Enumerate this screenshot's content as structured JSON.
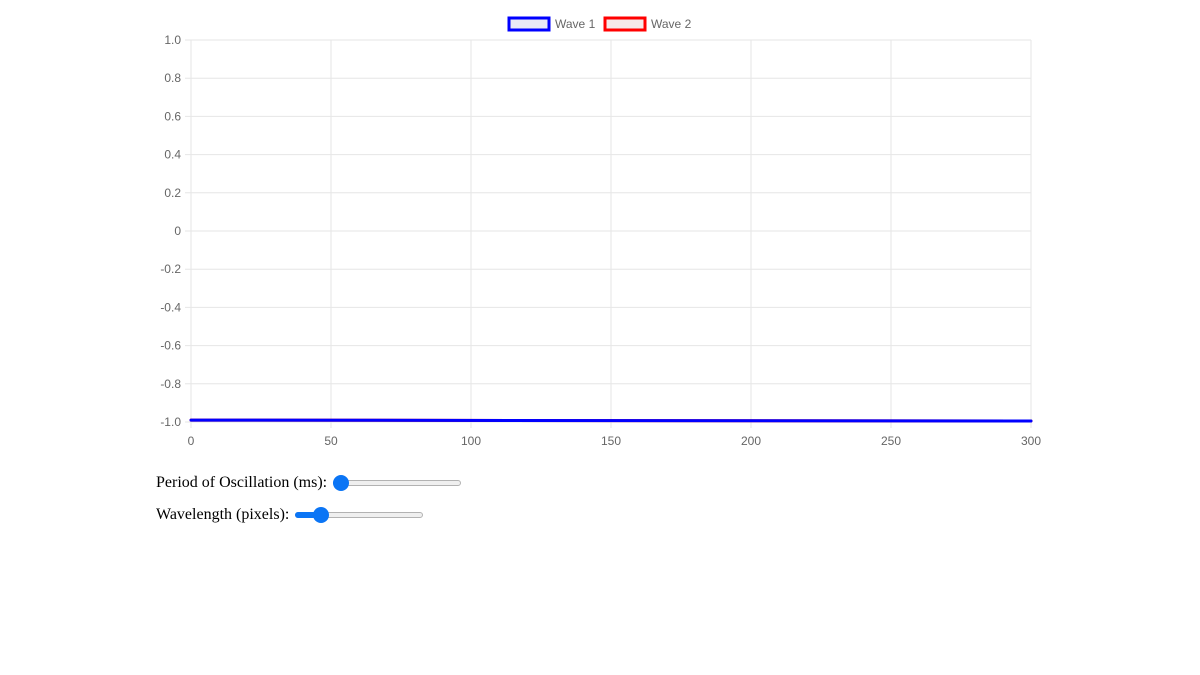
{
  "legend": [
    {
      "label": "Wave 1",
      "color": "#0000ff",
      "fill": "#e9e9f6"
    },
    {
      "label": "Wave 2",
      "color": "#ff0000",
      "fill": "#f6e9e9"
    }
  ],
  "chart_data": {
    "type": "line",
    "title": "",
    "xlabel": "",
    "ylabel": "",
    "xlim": [
      0,
      300
    ],
    "ylim": [
      -1.0,
      1.0
    ],
    "x_ticks": [
      "0",
      "50",
      "100",
      "150",
      "200",
      "250",
      "300"
    ],
    "y_ticks": [
      "1.0",
      "0.8",
      "0.6",
      "0.4",
      "0.2",
      "0",
      "-0.2",
      "-0.4",
      "-0.6",
      "-0.8",
      "-1.0"
    ],
    "grid": true,
    "legend_position": "top",
    "series": [
      {
        "name": "Wave 1",
        "color": "#0000ff",
        "x": [
          0,
          300
        ],
        "y": [
          -0.99,
          -0.995
        ]
      },
      {
        "name": "Wave 2",
        "color": "#ff0000",
        "x": [
          0,
          300
        ],
        "y": [
          -0.99,
          -0.995
        ]
      }
    ]
  },
  "controls": {
    "period": {
      "label": "Period of Oscillation (ms):",
      "value_fraction": 0.0
    },
    "wavelength": {
      "label": "Wavelength (pixels):",
      "value_fraction": 0.16
    }
  }
}
